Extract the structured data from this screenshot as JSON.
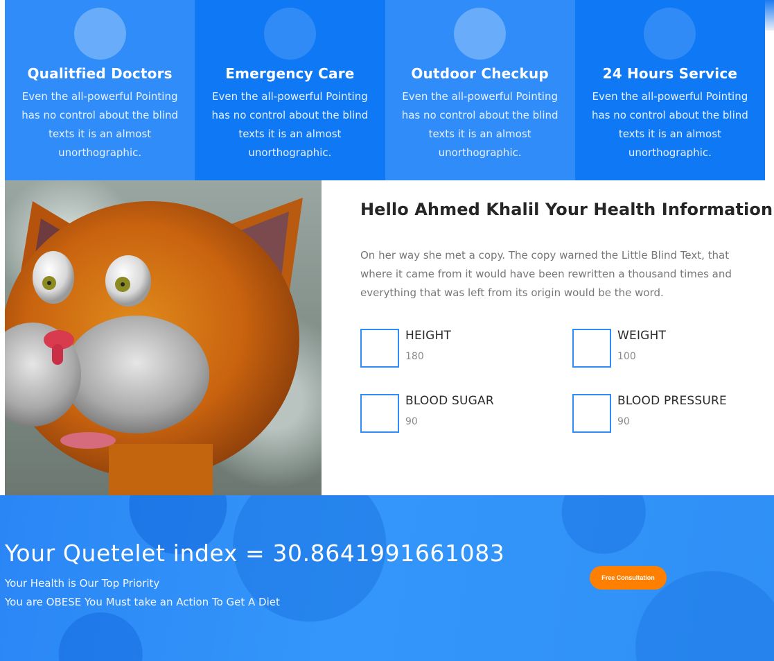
{
  "services": [
    {
      "title": "Qualitfied Doctors",
      "text": "Even the all-powerful Pointing has no control about the blind texts it is an almost unorthographic."
    },
    {
      "title": "Emergency Care",
      "text": "Even the all-powerful Pointing has no control about the blind texts it is an almost unorthographic."
    },
    {
      "title": "Outdoor Checkup",
      "text": "Even the all-powerful Pointing has no control about the blind texts it is an almost unorthographic."
    },
    {
      "title": "24 Hours Service",
      "text": "Even the all-powerful Pointing has no control about the blind texts it is an almost unorthographic."
    }
  ],
  "health": {
    "heading": "Hello Ahmed Khalil Your Health Information",
    "lead": "On her way she met a copy. The copy warned the Little Blind Text, that where it came from it would have been rewritten a thousand times and everything that was left from its origin would be the word.",
    "metrics": [
      {
        "label": "HEIGHT",
        "value": "180"
      },
      {
        "label": "WEIGHT",
        "value": "100"
      },
      {
        "label": "BLOOD SUGAR",
        "value": "90"
      },
      {
        "label": "BLOOD PRESSURE",
        "value": "90"
      }
    ]
  },
  "banner": {
    "index_text": "Your Quetelet index = 30.8641991661083",
    "line1": "Your Health is Our Top Priority",
    "line2": "You are OBESE You Must take an Action To Get A Diet",
    "cta_label": "Free Consultation"
  },
  "colors": {
    "primary_blue": "#2f8cf9",
    "dark_blue": "#0f78f5",
    "cta_orange": "#ff7f00"
  }
}
